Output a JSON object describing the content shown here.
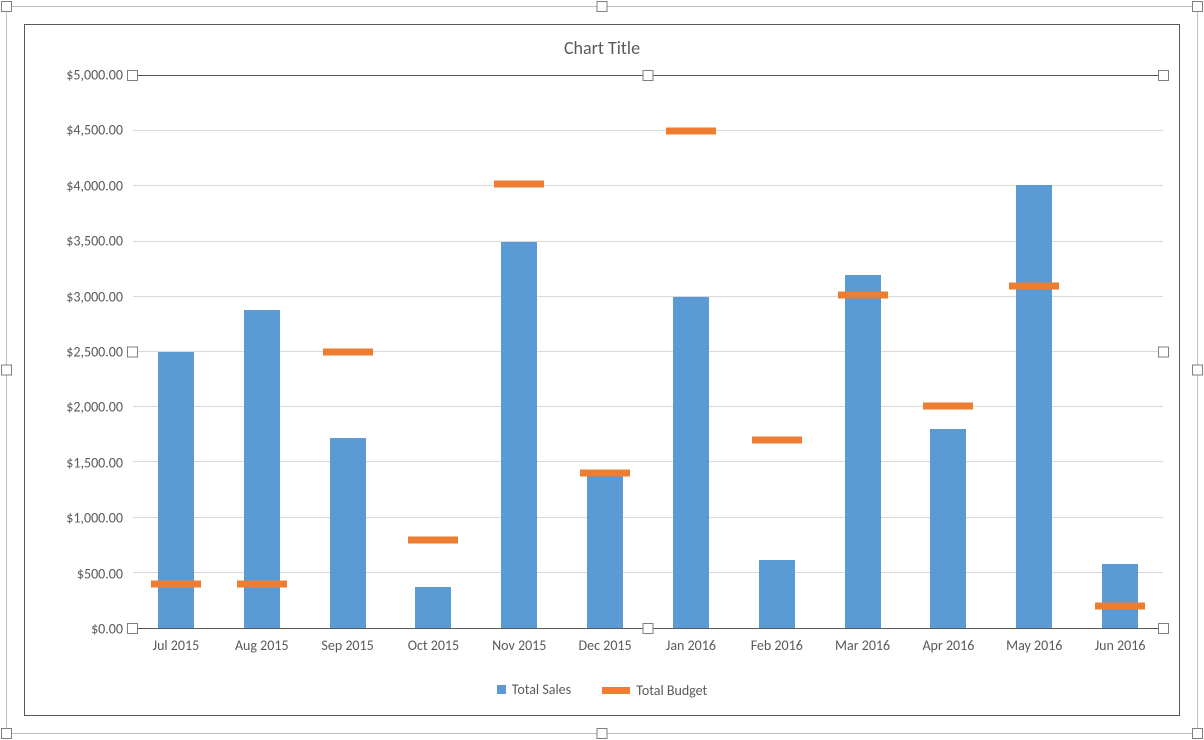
{
  "title": "Chart Title",
  "legend": {
    "sales": "Total Sales",
    "budget": "Total Budget"
  },
  "y_ticks": [
    "$0.00",
    "$500.00",
    "$1,000.00",
    "$1,500.00",
    "$2,000.00",
    "$2,500.00",
    "$3,000.00",
    "$3,500.00",
    "$4,000.00",
    "$4,500.00",
    "$5,000.00"
  ],
  "colors": {
    "bar": "#5b9bd5",
    "marker": "#ed7d31",
    "grid": "#d9d9d9",
    "axis_text": "#595959"
  },
  "chart_data": {
    "type": "bar",
    "title": "Chart Title",
    "xlabel": "",
    "ylabel": "",
    "ylim": [
      0,
      5000
    ],
    "categories": [
      "Jul 2015",
      "Aug 2015",
      "Sep 2015",
      "Oct 2015",
      "Nov 2015",
      "Dec 2015",
      "Jan 2016",
      "Feb 2016",
      "Mar 2016",
      "Apr 2016",
      "May 2016",
      "Jun 2016"
    ],
    "series": [
      {
        "name": "Total Sales",
        "type": "bar",
        "values": [
          2500,
          2880,
          1720,
          370,
          3500,
          1380,
          3000,
          620,
          3200,
          1800,
          4010,
          580
        ]
      },
      {
        "name": "Total Budget",
        "type": "marker",
        "values": [
          400,
          400,
          2500,
          800,
          4020,
          1400,
          4500,
          1700,
          3020,
          2010,
          3100,
          200
        ]
      }
    ],
    "y_tick_interval": 500,
    "grid": true,
    "legend_position": "bottom"
  }
}
